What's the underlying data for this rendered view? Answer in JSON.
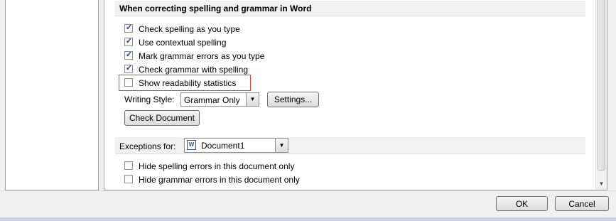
{
  "spelling_section": {
    "title": "When correcting spelling and grammar in Word",
    "options": [
      {
        "label": "Check spelling as you type",
        "checked": true
      },
      {
        "label": "Use contextual spelling",
        "checked": true
      },
      {
        "label": "Mark grammar errors as you type",
        "checked": true
      },
      {
        "label": "Check grammar with spelling",
        "checked": true
      },
      {
        "label": "Show readability statistics",
        "checked": false
      }
    ],
    "writing_style_label": "Writing Style:",
    "writing_style_value": "Grammar Only",
    "settings_button": "Settings...",
    "check_document_button": "Check Document"
  },
  "exceptions_section": {
    "label": "Exceptions for:",
    "document_value": "Document1",
    "doc_icon_text": "W",
    "options": [
      {
        "label": "Hide spelling errors in this document only",
        "checked": false
      },
      {
        "label": "Hide grammar errors in this document only",
        "checked": false
      }
    ]
  },
  "footer": {
    "ok_button": "OK",
    "cancel_button": "Cancel"
  },
  "glyphs": {
    "check": "✓",
    "dropdown_arrow": "▼",
    "scroll_down_arrow": "▼"
  },
  "colors": {
    "highlight_border": "#d84545",
    "section_header_bg": "#f1f1f1",
    "window_bg": "#f0f0f0"
  }
}
